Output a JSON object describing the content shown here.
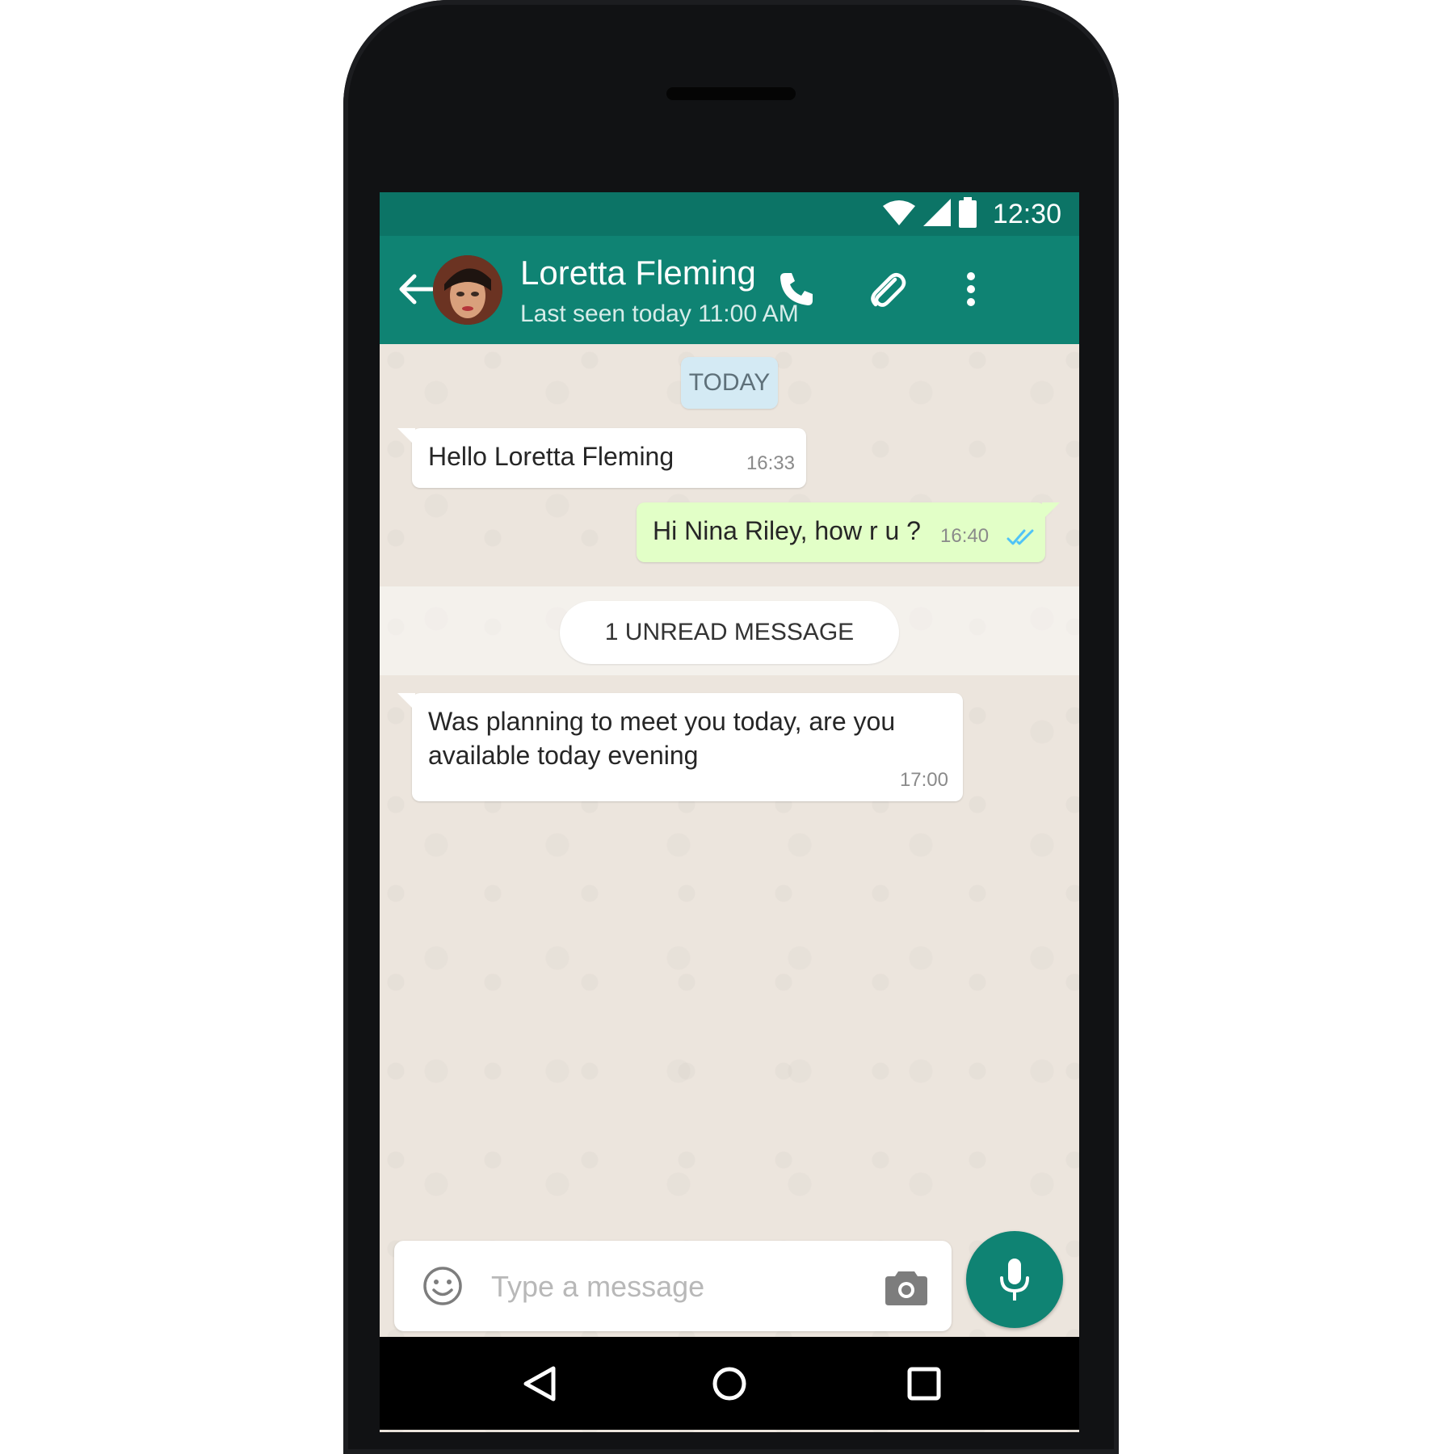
{
  "status_bar": {
    "time": "12:30",
    "icons": [
      "wifi-icon",
      "signal-icon",
      "battery-icon"
    ]
  },
  "header": {
    "contact_name": "Loretta Fleming",
    "last_seen": "Last seen today 11:00 AM",
    "icons": [
      "back-arrow-icon",
      "phone-icon",
      "paperclip-icon",
      "more-vert-icon"
    ]
  },
  "chat": {
    "date_chip": "TODAY",
    "messages": [
      {
        "direction": "incoming",
        "text": "Hello Loretta Fleming",
        "time": "16:33"
      },
      {
        "direction": "outgoing",
        "text": "Hi Nina Riley, how r u ?",
        "time": "16:40",
        "status": "read"
      },
      {
        "direction": "incoming",
        "text_lines": [
          "Was planning to meet you today, are you",
          "available today evening"
        ],
        "time": "17:00"
      }
    ],
    "unread_label": "1 UNREAD MESSAGE"
  },
  "composer": {
    "placeholder": "Type a message",
    "value": "",
    "icons": [
      "emoji-icon",
      "camera-icon",
      "mic-icon"
    ]
  },
  "navigation": {
    "icons": [
      "back-triangle-icon",
      "home-circle-icon",
      "recents-square-icon"
    ]
  },
  "colors": {
    "header": "#0f8373",
    "status_bar": "#0c7466",
    "chat_background": "#ece5dd",
    "outgoing_bubble": "#e2ffc7",
    "read_ticks": "#4fc3f7",
    "date_chip": "#d4eaf4"
  }
}
